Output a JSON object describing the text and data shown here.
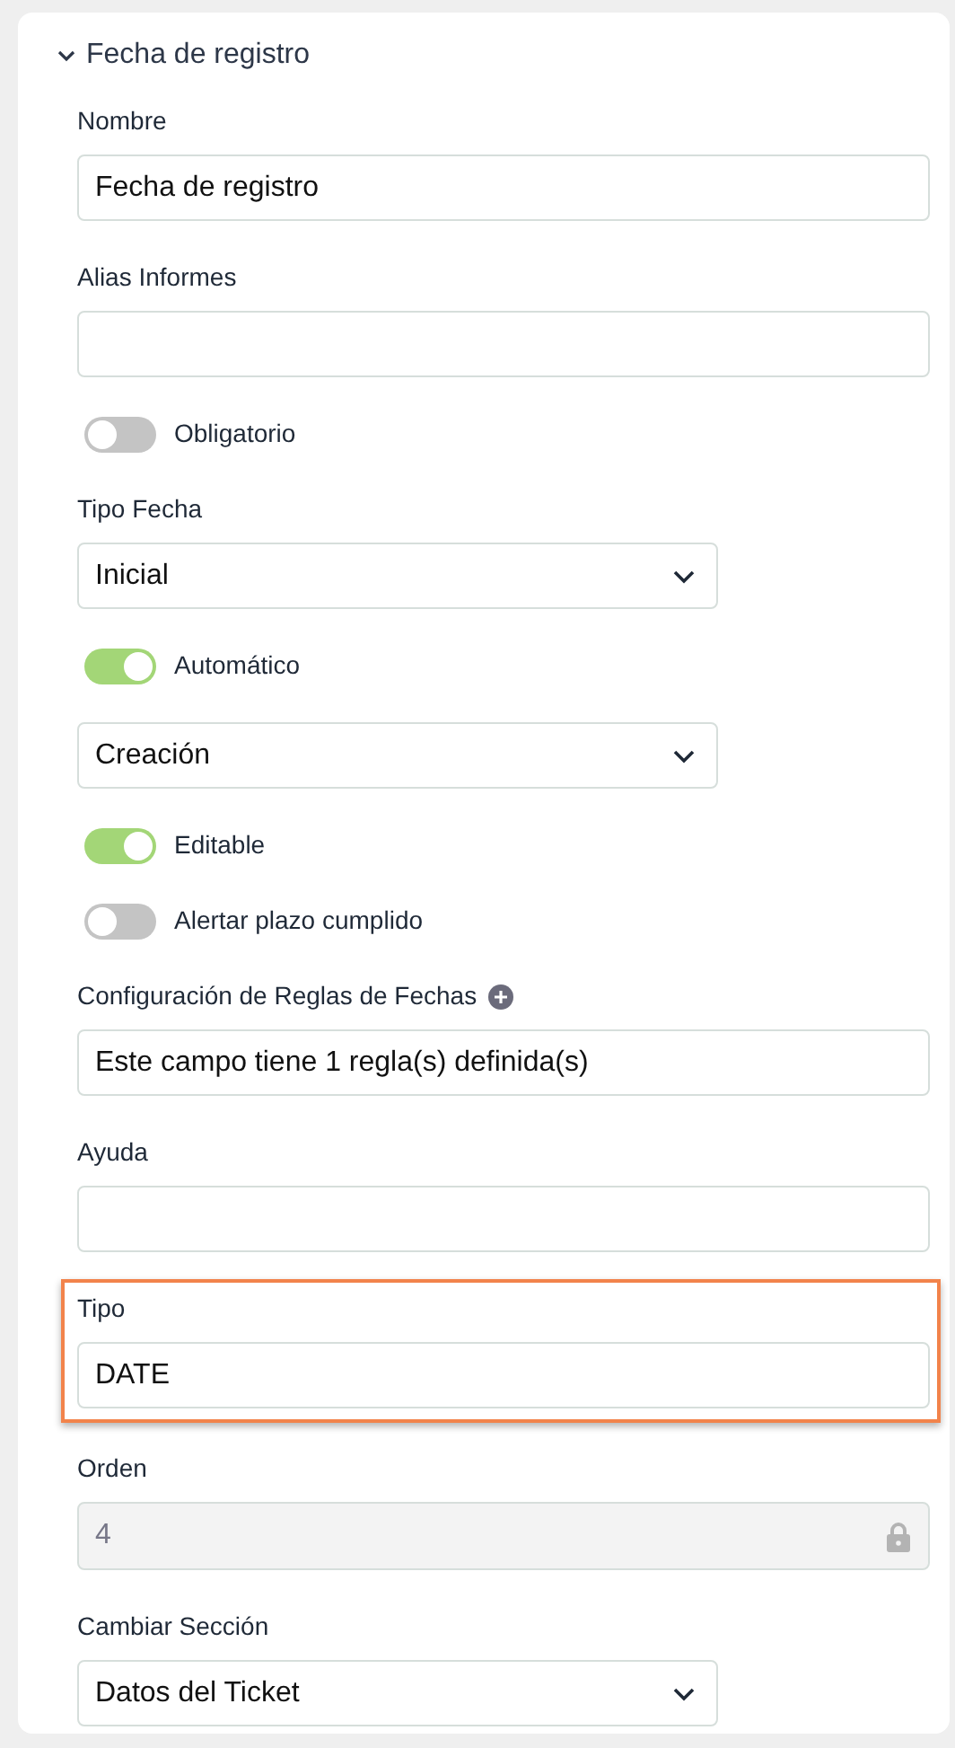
{
  "section": {
    "title": "Fecha de registro",
    "expanded": true
  },
  "fields": [
    {
      "kind": "text",
      "label": "Nombre",
      "value": "Fecha de registro"
    },
    {
      "kind": "text",
      "label": "Alias Informes"
    },
    {
      "kind": "toggle",
      "label": "Obligatorio",
      "on": false
    },
    {
      "kind": "select",
      "label": "Tipo Fecha",
      "value": "Inicial"
    },
    {
      "kind": "toggle",
      "label": "Automático",
      "on": true
    },
    {
      "kind": "select",
      "value": "Creación"
    },
    {
      "kind": "toggle",
      "label": "Editable",
      "on": true
    },
    {
      "kind": "toggle",
      "label": "Alertar plazo cumplido",
      "on": false
    },
    {
      "kind": "text",
      "label": "Configuración de Reglas de Fechas",
      "add_button": true,
      "value": "Este campo tiene 1 regla(s) definida(s)"
    },
    {
      "kind": "text",
      "label": "Ayuda"
    },
    {
      "kind": "text",
      "label": "Tipo",
      "value": "DATE",
      "highlighted": true
    },
    {
      "kind": "locked",
      "label": "Orden",
      "value": "4"
    },
    {
      "kind": "select",
      "label": "Cambiar Sección",
      "value": "Datos del Ticket"
    }
  ]
}
